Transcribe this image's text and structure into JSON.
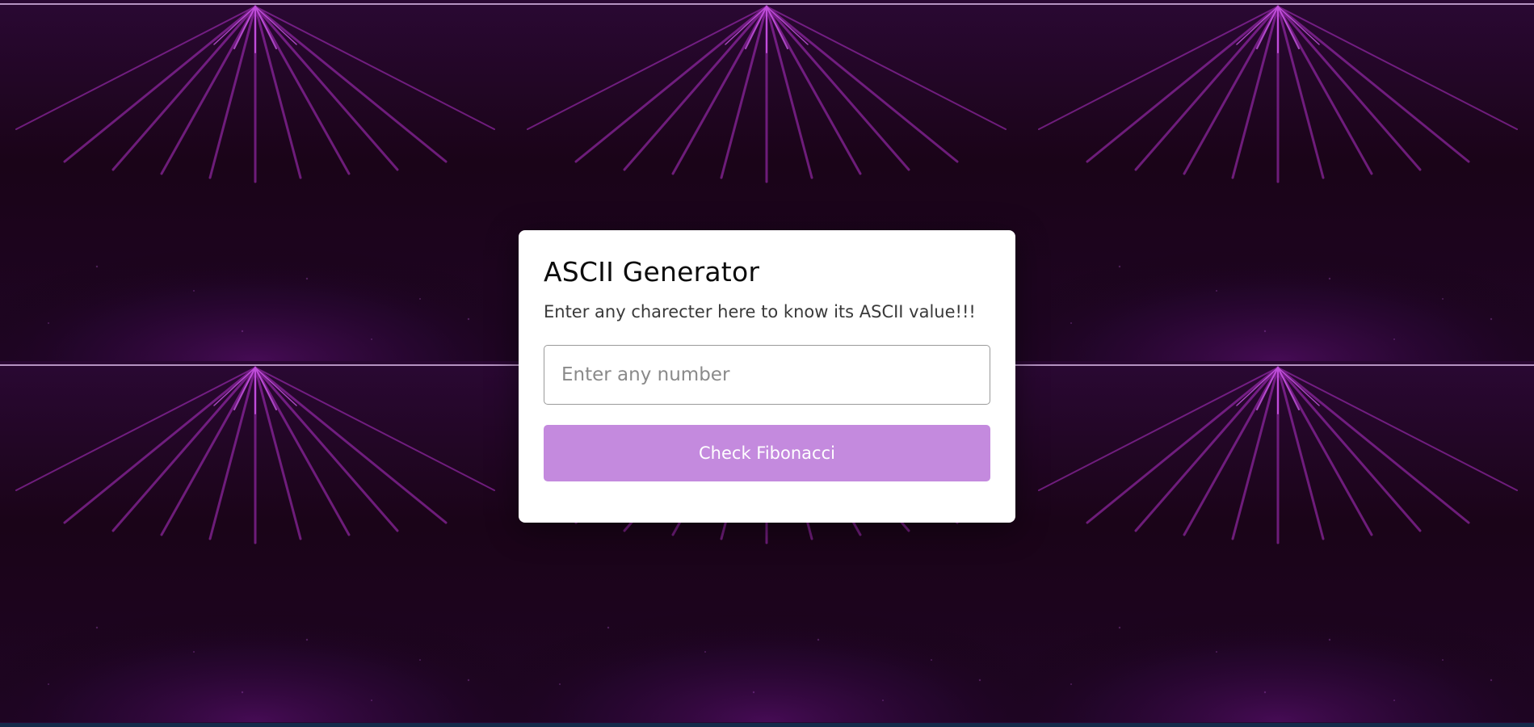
{
  "card": {
    "title": "ASCII Generator",
    "subtitle": "Enter any charecter here to know its ASCII value!!!",
    "input_placeholder": "Enter any number",
    "input_value": "",
    "button_label": "Check Fibonacci"
  },
  "colors": {
    "background": "#1a0418",
    "accent": "#c48ade",
    "card": "#ffffff",
    "bottom_strip": "#142a4a"
  }
}
